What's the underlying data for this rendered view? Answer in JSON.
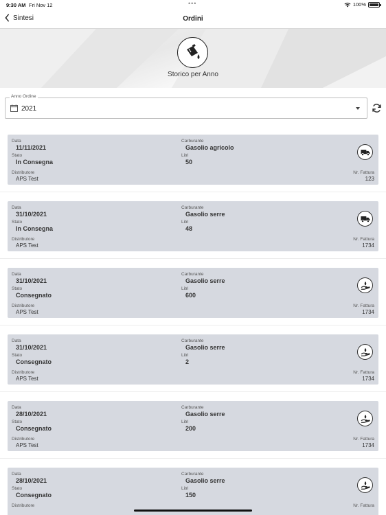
{
  "status_bar": {
    "time": "9:30 AM",
    "date": "Fri Nov 12",
    "battery": "100%"
  },
  "nav": {
    "back_label": "Sintesi",
    "title": "Ordini"
  },
  "hero": {
    "label": "Storico per Anno",
    "icon": "fuel-can-icon"
  },
  "year_field": {
    "legend": "Anno Ordine",
    "value": "2021"
  },
  "labels": {
    "data": "Data",
    "stato": "Stato",
    "distributore": "Distributore",
    "carburante": "Carburante",
    "litri": "Litri",
    "fattura": "Nr. Fattura"
  },
  "orders": [
    {
      "data": "11/11/2021",
      "stato": "In Consegna",
      "distributore": "APS Test",
      "carburante": "Gasolio agricolo",
      "litri": "50",
      "fattura": "123",
      "icon": "truck-icon"
    },
    {
      "data": "31/10/2021",
      "stato": "In Consegna",
      "distributore": "APS Test",
      "carburante": "Gasolio serre",
      "litri": "48",
      "fattura": "1734",
      "icon": "truck-icon"
    },
    {
      "data": "31/10/2021",
      "stato": "Consegnato",
      "distributore": "APS Test",
      "carburante": "Gasolio serre",
      "litri": "600",
      "fattura": "1734",
      "icon": "hand-drop-icon"
    },
    {
      "data": "31/10/2021",
      "stato": "Consegnato",
      "distributore": "APS Test",
      "carburante": "Gasolio serre",
      "litri": "2",
      "fattura": "1734",
      "icon": "hand-drop-icon"
    },
    {
      "data": "28/10/2021",
      "stato": "Consegnato",
      "distributore": "APS Test",
      "carburante": "Gasolio serre",
      "litri": "200",
      "fattura": "1734",
      "icon": "hand-drop-icon"
    },
    {
      "data": "28/10/2021",
      "stato": "Consegnato",
      "distributore": "",
      "carburante": "Gasolio serre",
      "litri": "150",
      "fattura": "",
      "icon": "hand-drop-icon"
    }
  ]
}
